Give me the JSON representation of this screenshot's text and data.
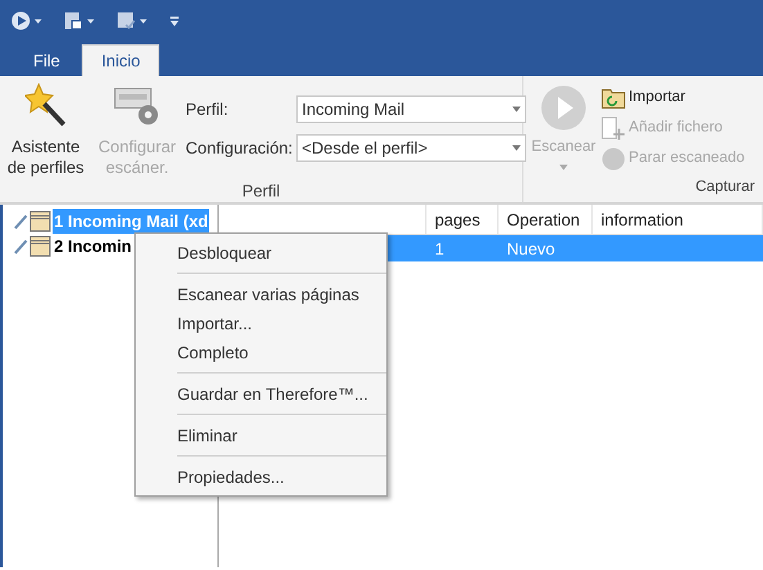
{
  "ribbon_tabs": [
    {
      "label": "File",
      "selected": false
    },
    {
      "label": "Inicio",
      "selected": true
    }
  ],
  "perfil_group": {
    "buttons": [
      {
        "label": "Asistente de perfiles",
        "disabled": false
      },
      {
        "label": "Configurar escáner.",
        "disabled": true
      }
    ],
    "fields": [
      {
        "label": "Perfil:",
        "value": "Incoming Mail"
      },
      {
        "label": "Configuración:",
        "value": "<Desde el perfil>"
      }
    ],
    "group_label": "Perfil"
  },
  "capturar_group": {
    "scan_button": {
      "label": "Escanear",
      "disabled": true
    },
    "actions": [
      {
        "label": "Importar",
        "kind": "import",
        "disabled": false
      },
      {
        "label": "Añadir fichero",
        "kind": "add",
        "disabled": true
      },
      {
        "label": "Parar escaneado",
        "kind": "stop",
        "disabled": true
      }
    ],
    "group_label": "Capturar"
  },
  "tree": [
    {
      "label": "1 Incoming Mail (xd",
      "selected": true
    },
    {
      "label": "2 Incomin",
      "selected": false
    }
  ],
  "table": {
    "columns": [
      "pages",
      "Operation",
      "information"
    ],
    "rows": [
      {
        "cells": [
          "1",
          "Nuevo",
          ""
        ],
        "selected": true
      }
    ]
  },
  "context_menu": [
    {
      "label": "Desbloquear",
      "separator_after": true
    },
    {
      "label": "Escanear varias páginas",
      "separator_after": false
    },
    {
      "label": "Importar...",
      "separator_after": false
    },
    {
      "label": "Completo",
      "separator_after": true
    },
    {
      "label": "Guardar en Therefore™...",
      "separator_after": true
    },
    {
      "label": "Eliminar",
      "separator_after": true
    },
    {
      "label": "Propiedades...",
      "separator_after": false
    }
  ]
}
